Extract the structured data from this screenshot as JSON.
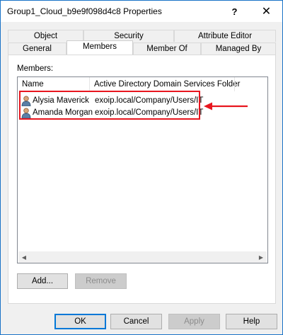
{
  "window": {
    "title": "Group1_Cloud_b9e9f098d4c8 Properties",
    "help_glyph": "?",
    "close_glyph": "✕"
  },
  "tabs_row1": [
    {
      "label": "Object"
    },
    {
      "label": "Security"
    },
    {
      "label": "Attribute Editor"
    }
  ],
  "tabs_row2": [
    {
      "label": "General"
    },
    {
      "label": "Members",
      "active": true
    },
    {
      "label": "Member Of"
    },
    {
      "label": "Managed By"
    }
  ],
  "members": {
    "label": "Members:",
    "columns": [
      "Name",
      "Active Directory Domain Services Folder"
    ],
    "rows": [
      {
        "name": "Alysia Maverick",
        "folder": "exoip.local/Company/Users/IT"
      },
      {
        "name": "Amanda Morgan",
        "folder": "exoip.local/Company/Users/IT"
      }
    ],
    "add_label": "Add...",
    "remove_label": "Remove"
  },
  "footer": {
    "ok_label": "OK",
    "cancel_label": "Cancel",
    "apply_label": "Apply",
    "help_label": "Help"
  },
  "colors": {
    "highlight": "#e8161f",
    "accent": "#0078d7"
  }
}
